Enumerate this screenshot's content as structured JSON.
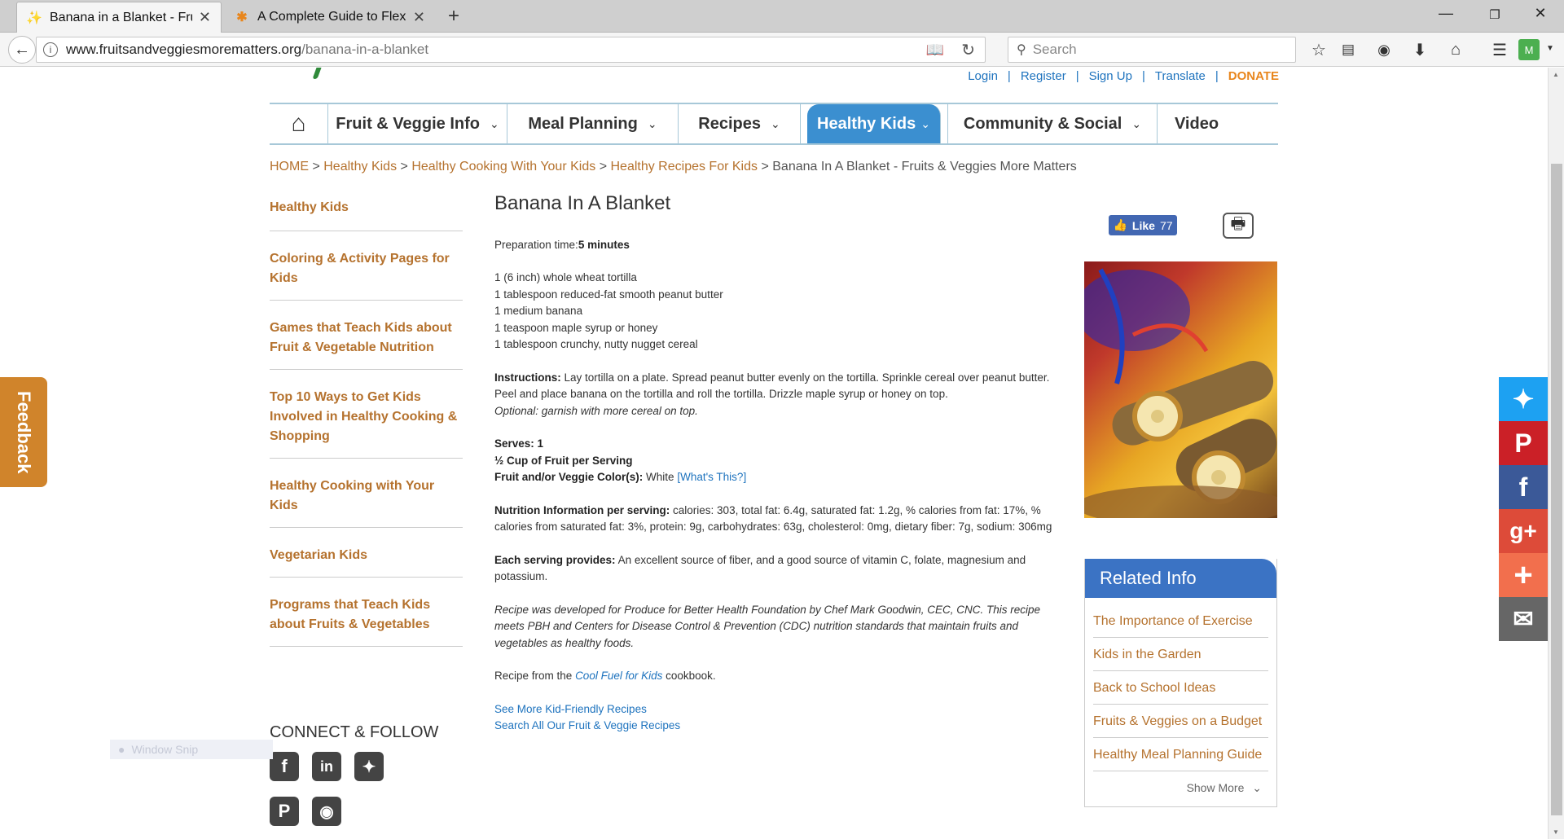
{
  "browser": {
    "tabs": [
      {
        "title": "Banana in a Blanket - Fruits & Veggies More Matters",
        "active": true
      },
      {
        "title": "A Complete Guide to Flexbox | CSS-Tricks",
        "active": false
      }
    ],
    "url_domain": "www.fruitsandveggiesmorematters.org",
    "url_path": "/banana-in-a-blanket",
    "search_placeholder": "Search"
  },
  "header": {
    "links": [
      "Login",
      "Register",
      "Sign Up",
      "Translate",
      "DONATE"
    ]
  },
  "nav": {
    "items": [
      {
        "label": "Fruit & Veggie Info",
        "chevron": true
      },
      {
        "label": "Meal Planning",
        "chevron": true
      },
      {
        "label": "Recipes",
        "chevron": true
      },
      {
        "label": "Healthy Kids",
        "chevron": true,
        "active": true
      },
      {
        "label": "Community & Social",
        "chevron": true
      },
      {
        "label": "Video",
        "chevron": false
      }
    ]
  },
  "breadcrumb": {
    "links": [
      "HOME",
      "Healthy Kids",
      "Healthy Cooking With Your Kids",
      "Healthy Recipes For Kids"
    ],
    "current": "Banana In A Blanket - Fruits & Veggies More Matters",
    "separator": ">"
  },
  "sidebar": {
    "items": [
      "Healthy Kids",
      "Coloring & Activity Pages for Kids",
      "Games that Teach Kids about Fruit & Vegetable Nutrition",
      "Top 10 Ways to Get Kids Involved in Healthy Cooking & Shopping",
      "Healthy Cooking with Your Kids",
      "Vegetarian Kids",
      "Programs that Teach Kids about Fruits & Vegetables"
    ],
    "connect_title": "CONNECT & FOLLOW"
  },
  "recipe": {
    "title": "Banana In A Blanket",
    "prep_label": "Preparation time:",
    "prep_value": "5 minutes",
    "ingredients": [
      "1 (6 inch) whole wheat tortilla",
      "1 tablespoon reduced-fat smooth peanut butter",
      "1 medium banana",
      "1 teaspoon maple syrup or honey",
      "1 tablespoon crunchy, nutty nugget cereal"
    ],
    "instructions_label": "Instructions:",
    "instructions_1": "Lay tortilla on a plate. Spread peanut butter evenly on the tortilla. Sprinkle cereal over peanut butter.",
    "instructions_2": "Peel and place banana on the tortilla and roll the tortilla. Drizzle maple syrup or honey on top.",
    "instructions_optional": "Optional: garnish with more cereal on top.",
    "serves": "Serves: 1",
    "cup": "½ Cup of Fruit per Serving",
    "color_label": "Fruit and/or Veggie Color(s):",
    "color_value": "White",
    "whats_this": "What's This?",
    "nutrition_label": "Nutrition Information per serving:",
    "nutrition_value": "calories: 303, total fat: 6.4g, saturated fat: 1.2g, % calories from fat: 17%, % calories from saturated fat: 3%, protein: 9g, carbohydrates: 63g, cholesterol: 0mg, dietary fiber: 7g, sodium: 306mg",
    "provides_label": "Each serving provides:",
    "provides_value": "An excellent source of fiber, and a good source of vitamin C, folate, magnesium and potassium.",
    "credit": "Recipe was developed for Produce for Better Health Foundation by Chef Mark Goodwin, CEC, CNC. This recipe meets PBH and Centers for Disease Control & Prevention (CDC) nutrition standards that maintain fruits and vegetables as healthy foods.",
    "source_prefix": "Recipe from the",
    "source_link": "Cool Fuel for Kids",
    "source_suffix": "cookbook.",
    "more_link": "See More Kid-Friendly Recipes",
    "search_link": "Search All Our Fruit & Veggie Recipes"
  },
  "like": {
    "label": "Like",
    "count": "77"
  },
  "related": {
    "title": "Related Info",
    "items": [
      "The Importance of Exercise",
      "Kids in the Garden",
      "Back to School Ideas",
      "Fruits & Veggies on a Budget",
      "Healthy Meal Planning Guide"
    ],
    "show_more": "Show More"
  },
  "feedback": "Feedback",
  "snip": "Window Snip",
  "colors": {
    "accent": "#b5722e",
    "nav_active": "#3b8fd0",
    "related_header": "#3b73c4",
    "feedback": "#d0842b"
  }
}
